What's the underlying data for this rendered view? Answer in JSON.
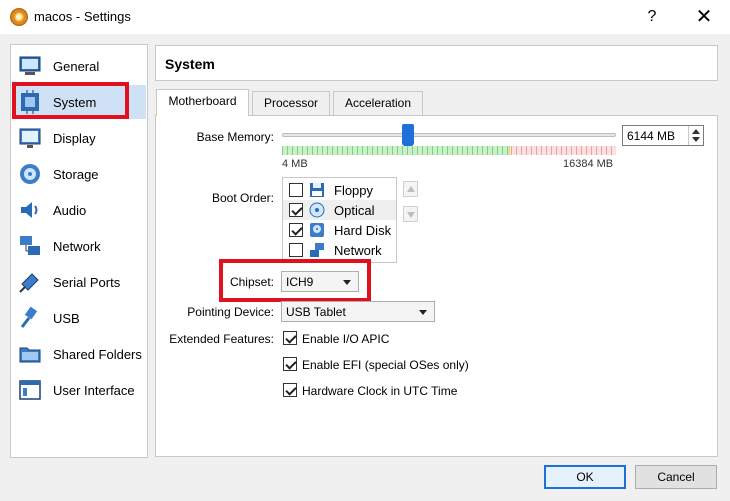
{
  "window": {
    "title": "macos - Settings",
    "help_glyph": "?",
    "close_glyph": "✕"
  },
  "sidebar": {
    "items": [
      {
        "label": "General",
        "icon": "monitor-icon"
      },
      {
        "label": "System",
        "icon": "chip-icon",
        "selected": true
      },
      {
        "label": "Display",
        "icon": "display-icon"
      },
      {
        "label": "Storage",
        "icon": "storage-icon"
      },
      {
        "label": "Audio",
        "icon": "audio-icon"
      },
      {
        "label": "Network",
        "icon": "network-icon"
      },
      {
        "label": "Serial Ports",
        "icon": "serial-port-icon"
      },
      {
        "label": "USB",
        "icon": "usb-icon"
      },
      {
        "label": "Shared Folders",
        "icon": "shared-folder-icon"
      },
      {
        "label": "User Interface",
        "icon": "user-interface-icon"
      }
    ]
  },
  "header": {
    "title": "System"
  },
  "tabs": [
    {
      "label": "Motherboard",
      "active": true
    },
    {
      "label": "Processor"
    },
    {
      "label": "Acceleration"
    }
  ],
  "motherboard": {
    "base_memory": {
      "label": "Base Memory:",
      "value": "6144 MB",
      "min_label": "4 MB",
      "max_label": "16384 MB",
      "value_mb": 6144,
      "min_mb": 4,
      "max_mb": 16384,
      "colors": {
        "safe": "#7fd07f",
        "warn": "#e6d36a",
        "danger": "#f0a0a0",
        "handle": "#1e6fd9"
      }
    },
    "boot_order": {
      "label": "Boot Order:",
      "items": [
        {
          "label": "Floppy",
          "checked": false,
          "icon": "floppy-icon"
        },
        {
          "label": "Optical",
          "checked": true,
          "icon": "optical-disc-icon"
        },
        {
          "label": "Hard Disk",
          "checked": true,
          "icon": "hard-disk-icon"
        },
        {
          "label": "Network",
          "checked": false,
          "icon": "network-icon"
        }
      ]
    },
    "chipset": {
      "label": "Chipset:",
      "value": "ICH9"
    },
    "pointing_device": {
      "label": "Pointing Device:",
      "value": "USB Tablet"
    },
    "extended_features": {
      "label": "Extended Features:",
      "items": [
        {
          "label": "Enable I/O APIC",
          "checked": true
        },
        {
          "label": "Enable EFI (special OSes only)",
          "checked": true
        },
        {
          "label": "Hardware Clock in UTC Time",
          "checked": true
        }
      ]
    }
  },
  "buttons": {
    "ok": "OK",
    "cancel": "Cancel"
  },
  "highlight_color": "#e0101e"
}
